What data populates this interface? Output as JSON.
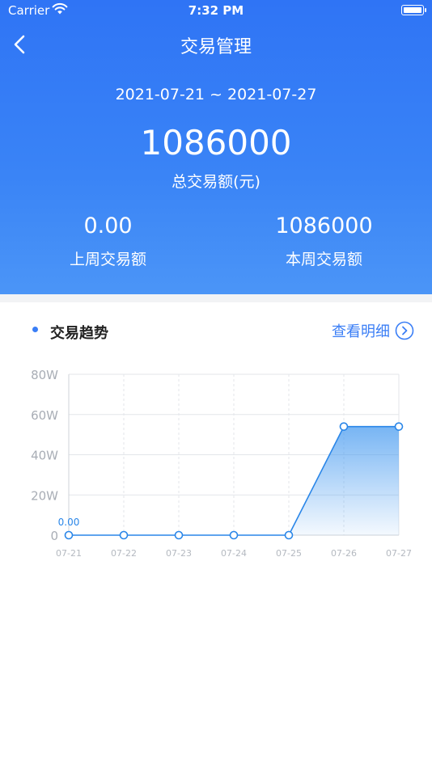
{
  "status_bar": {
    "carrier": "Carrier",
    "time": "7:32 PM"
  },
  "nav": {
    "title": "交易管理",
    "back_icon": "chevron-left-icon"
  },
  "summary": {
    "date_range": "2021-07-21 ~ 2021-07-27",
    "total_value": "1086000",
    "total_label": "总交易额(元)",
    "last_week_value": "0.00",
    "last_week_label": "上周交易额",
    "this_week_value": "1086000",
    "this_week_label": "本周交易额"
  },
  "trend": {
    "title": "交易趋势",
    "detail_link": "查看明细",
    "detail_icon": "chevron-right-circle-icon"
  },
  "colors": {
    "header_blue": "#2f74f5",
    "accent": "#3a7ef6",
    "line": "#2a86e8"
  },
  "chart_data": {
    "type": "area",
    "categories": [
      "07-21",
      "07-22",
      "07-23",
      "07-24",
      "07-25",
      "07-26",
      "07-27"
    ],
    "series": [
      {
        "values": [
          0,
          0,
          0,
          0,
          0,
          540000,
          540000
        ]
      }
    ],
    "ylim": [
      0,
      800000
    ],
    "ytick_values": [
      0,
      200000,
      400000,
      600000,
      800000
    ],
    "ytick_labels": [
      "0",
      "20W",
      "40W",
      "60W",
      "80W"
    ],
    "annotations": [
      {
        "category": "07-21",
        "text": "0.00"
      }
    ],
    "grid": true
  }
}
